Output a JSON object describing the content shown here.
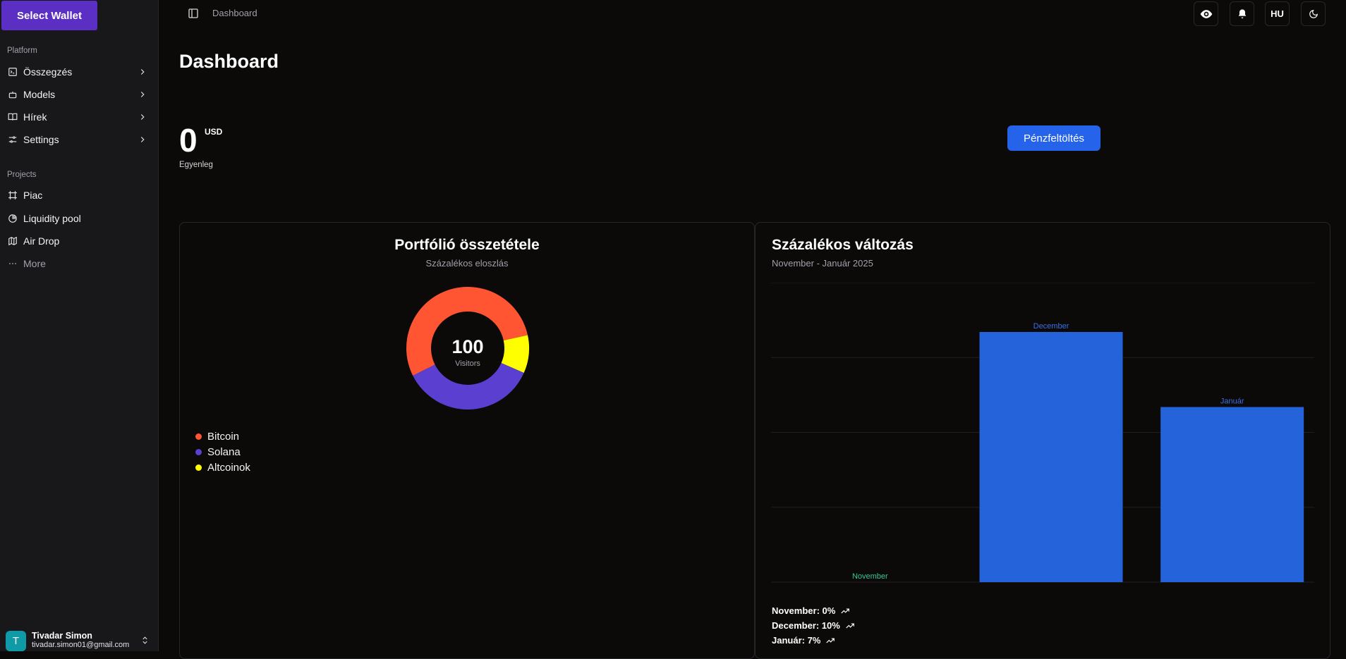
{
  "sidebar": {
    "wallet_button": "Select Wallet",
    "platform_label": "Platform",
    "platform_items": [
      {
        "label": "Összegzés",
        "icon": "terminal-icon"
      },
      {
        "label": "Models",
        "icon": "bot-icon"
      },
      {
        "label": "Hírek",
        "icon": "book-icon"
      },
      {
        "label": "Settings",
        "icon": "settings-icon"
      }
    ],
    "projects_label": "Projects",
    "project_items": [
      {
        "label": "Piac",
        "icon": "frame-icon"
      },
      {
        "label": "Liquidity pool",
        "icon": "pie-chart-icon"
      },
      {
        "label": "Air Drop",
        "icon": "map-icon"
      }
    ],
    "more_label": "More",
    "user": {
      "initial": "T",
      "name": "Tivadar Simon",
      "email": "tivadar.simon01@gmail.com"
    }
  },
  "header": {
    "breadcrumb": "Dashboard",
    "language": "HU"
  },
  "main": {
    "title": "Dashboard",
    "balance_value": "0",
    "balance_currency": "USD",
    "balance_label": "Egyenleg",
    "topup_button": "Pénzfeltöltés"
  },
  "portfolio": {
    "title": "Portfólió összetétele",
    "subtitle": "Százalékos eloszlás",
    "center_value": "100",
    "center_label": "Visitors"
  },
  "change": {
    "title": "Százalékos változás",
    "subtitle": "November - Január 2025",
    "stats": [
      "November: 0%",
      "December: 10%",
      "Január: 7%"
    ]
  },
  "colors": {
    "accent": "#5b2fc4",
    "primary": "#2563eb",
    "bitcoin": "#ff5533",
    "solana": "#5b3fd1",
    "altcoin": "#ffff00",
    "bar": "#2563db"
  },
  "chart_data": [
    {
      "type": "pie",
      "title": "Portfólió összetétele",
      "subtitle": "Százalékos eloszlás",
      "categories": [
        "Bitcoin",
        "Solana",
        "Altcoinok"
      ],
      "values": [
        54,
        36,
        10
      ],
      "colors": [
        "#ff5533",
        "#5b3fd1",
        "#ffff00"
      ],
      "center_text": "100",
      "center_label": "Visitors",
      "legend_position": "bottom-left"
    },
    {
      "type": "bar",
      "title": "Százalékos változás",
      "subtitle": "November - Január 2025",
      "categories": [
        "November",
        "December",
        "Január"
      ],
      "values": [
        0,
        10,
        7
      ],
      "ylim": [
        0,
        12
      ],
      "grid": true
    }
  ]
}
